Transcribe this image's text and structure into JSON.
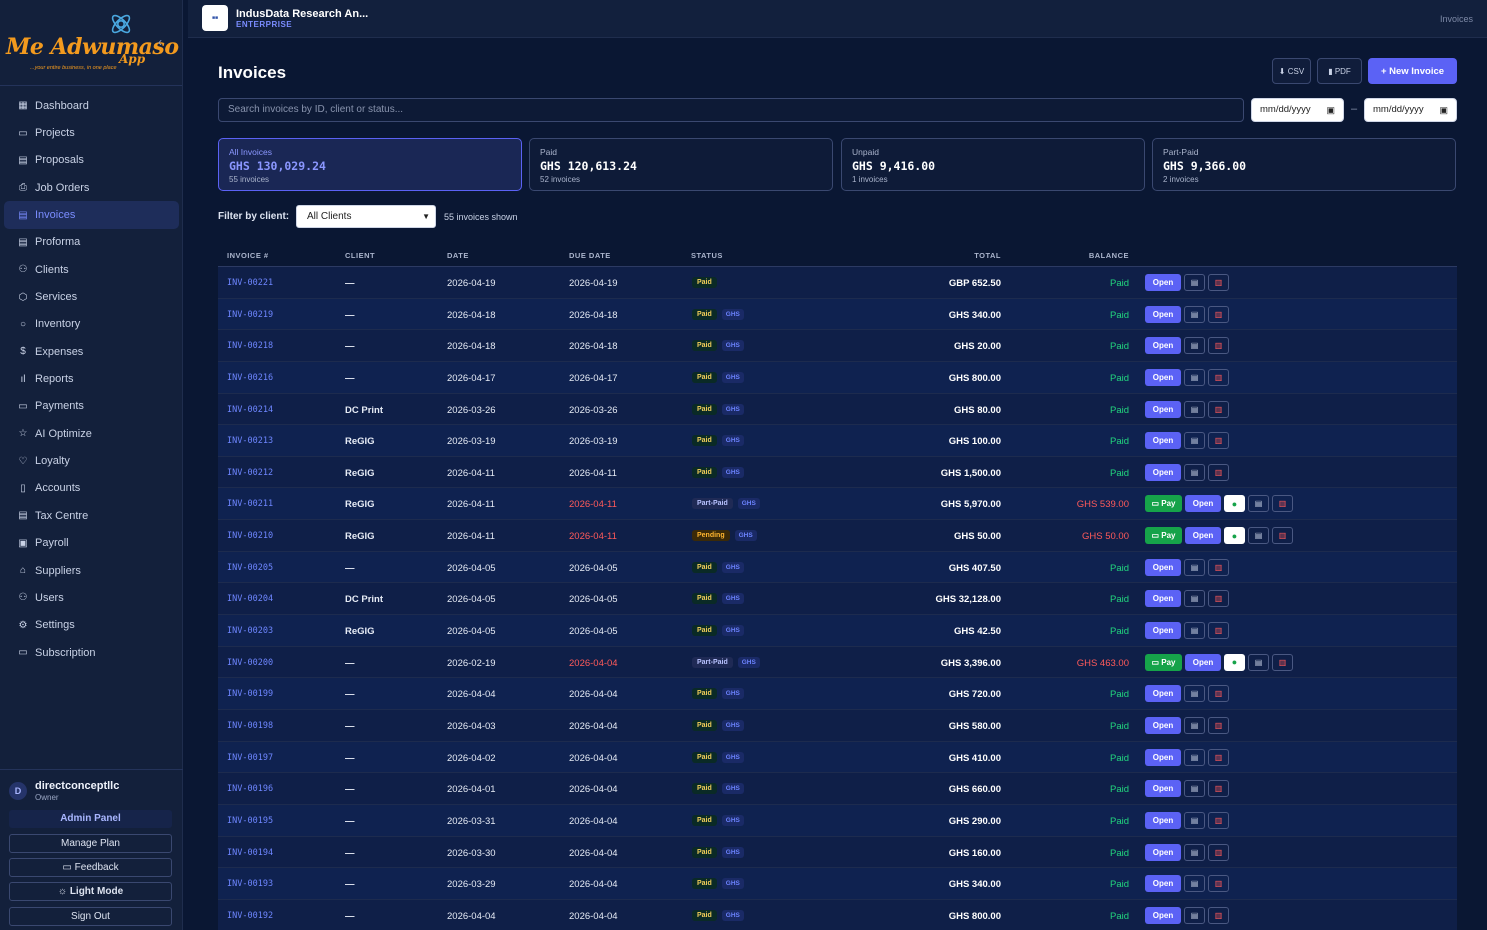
{
  "sidebar": {
    "logo_text": "Me Adwumaso",
    "logo_app": "App",
    "logo_tagline": "...your entire business, in one place",
    "items": [
      {
        "label": "Dashboard",
        "icon": "grid-icon",
        "glyph": "▦"
      },
      {
        "label": "Projects",
        "icon": "folder-icon",
        "glyph": "▭"
      },
      {
        "label": "Proposals",
        "icon": "file-icon",
        "glyph": "▤"
      },
      {
        "label": "Job Orders",
        "icon": "printer-icon",
        "glyph": "⎙"
      },
      {
        "label": "Invoices",
        "icon": "file-text-icon",
        "glyph": "▤",
        "active": true
      },
      {
        "label": "Proforma",
        "icon": "file-icon",
        "glyph": "▤"
      },
      {
        "label": "Clients",
        "icon": "users-icon",
        "glyph": "⚇"
      },
      {
        "label": "Services",
        "icon": "box-icon",
        "glyph": "⬡"
      },
      {
        "label": "Inventory",
        "icon": "circle-icon",
        "glyph": "○"
      },
      {
        "label": "Expenses",
        "icon": "dollar-icon",
        "glyph": "$"
      },
      {
        "label": "Reports",
        "icon": "bar-chart-icon",
        "glyph": "ıl"
      },
      {
        "label": "Payments",
        "icon": "credit-card-icon",
        "glyph": "▭"
      },
      {
        "label": "AI Optimize",
        "icon": "star-icon",
        "glyph": "☆"
      },
      {
        "label": "Loyalty",
        "icon": "heart-icon",
        "glyph": "♡"
      },
      {
        "label": "Accounts",
        "icon": "book-icon",
        "glyph": "▯"
      },
      {
        "label": "Tax Centre",
        "icon": "receipt-icon",
        "glyph": "▤"
      },
      {
        "label": "Payroll",
        "icon": "briefcase-icon",
        "glyph": "▣"
      },
      {
        "label": "Suppliers",
        "icon": "store-icon",
        "glyph": "⌂"
      },
      {
        "label": "Users",
        "icon": "user-check-icon",
        "glyph": "⚇"
      },
      {
        "label": "Settings",
        "icon": "gear-icon",
        "glyph": "⚙"
      },
      {
        "label": "Subscription",
        "icon": "credit-card-icon",
        "glyph": "▭"
      }
    ],
    "user": {
      "initial": "D",
      "name": "directconceptllc",
      "role": "Owner"
    },
    "admin_panel": "Admin Panel",
    "manage_plan": "Manage Plan",
    "feedback": "Feedback",
    "light_mode": "Light Mode",
    "sign_out": "Sign Out"
  },
  "header": {
    "org_name": "IndusData Research An...",
    "org_tier": "ENTERPRISE",
    "breadcrumb": "Invoices"
  },
  "page": {
    "title": "Invoices",
    "csv_label": "CSV",
    "pdf_label": "PDF",
    "new_invoice_label": "+ New Invoice",
    "search_placeholder": "Search invoices by ID, client or status...",
    "date_from": "mm/dd/yyyy",
    "date_to": "mm/dd/yyyy",
    "date_separator": "–"
  },
  "summary_cards": [
    {
      "label": "All Invoices",
      "value": "GHS 130,029.24",
      "sub": "55 invoices",
      "active": true
    },
    {
      "label": "Paid",
      "value": "GHS 120,613.24",
      "sub": "52 invoices"
    },
    {
      "label": "Unpaid",
      "value": "GHS 9,416.00",
      "sub": "1 invoices"
    },
    {
      "label": "Part-Paid",
      "value": "GHS 9,366.00",
      "sub": "2 invoices"
    }
  ],
  "filter": {
    "label": "Filter by client:",
    "selected": "All Clients",
    "count_text": "55 invoices shown"
  },
  "table": {
    "columns": [
      "INVOICE #",
      "CLIENT",
      "DATE",
      "DUE DATE",
      "STATUS",
      "TOTAL",
      "BALANCE"
    ],
    "rows": [
      {
        "inv": "INV-00221",
        "client": "—",
        "date": "2026-04-19",
        "due": "2026-04-19",
        "status": "Paid",
        "cur": "",
        "total": "GBP 652.50",
        "balance": "Paid"
      },
      {
        "inv": "INV-00219",
        "client": "—",
        "date": "2026-04-18",
        "due": "2026-04-18",
        "status": "Paid",
        "cur": "GHS",
        "total": "GHS 340.00",
        "balance": "Paid"
      },
      {
        "inv": "INV-00218",
        "client": "—",
        "date": "2026-04-18",
        "due": "2026-04-18",
        "status": "Paid",
        "cur": "GHS",
        "total": "GHS 20.00",
        "balance": "Paid"
      },
      {
        "inv": "INV-00216",
        "client": "—",
        "date": "2026-04-17",
        "due": "2026-04-17",
        "status": "Paid",
        "cur": "GHS",
        "total": "GHS 800.00",
        "balance": "Paid"
      },
      {
        "inv": "INV-00214",
        "client": "DC Print",
        "date": "2026-03-26",
        "due": "2026-03-26",
        "status": "Paid",
        "cur": "GHS",
        "total": "GHS 80.00",
        "balance": "Paid"
      },
      {
        "inv": "INV-00213",
        "client": "ReGIG",
        "date": "2026-03-19",
        "due": "2026-03-19",
        "status": "Paid",
        "cur": "GHS",
        "total": "GHS 100.00",
        "balance": "Paid"
      },
      {
        "inv": "INV-00212",
        "client": "ReGIG",
        "date": "2026-04-11",
        "due": "2026-04-11",
        "status": "Paid",
        "cur": "GHS",
        "total": "GHS 1,500.00",
        "balance": "Paid"
      },
      {
        "inv": "INV-00211",
        "client": "ReGIG",
        "date": "2026-04-11",
        "due": "2026-04-11",
        "overdue": true,
        "status": "Part-Paid",
        "cur": "GHS",
        "total": "GHS 5,970.00",
        "balance": "GHS 539.00",
        "owed": true
      },
      {
        "inv": "INV-00210",
        "client": "ReGIG",
        "date": "2026-04-11",
        "due": "2026-04-11",
        "overdue": true,
        "status": "Pending",
        "cur": "GHS",
        "total": "GHS 50.00",
        "balance": "GHS 50.00",
        "owed": true
      },
      {
        "inv": "INV-00205",
        "client": "—",
        "date": "2026-04-05",
        "due": "2026-04-05",
        "status": "Paid",
        "cur": "GHS",
        "total": "GHS 407.50",
        "balance": "Paid"
      },
      {
        "inv": "INV-00204",
        "client": "DC Print",
        "date": "2026-04-05",
        "due": "2026-04-05",
        "status": "Paid",
        "cur": "GHS",
        "total": "GHS 32,128.00",
        "balance": "Paid"
      },
      {
        "inv": "INV-00203",
        "client": "ReGIG",
        "date": "2026-04-05",
        "due": "2026-04-05",
        "status": "Paid",
        "cur": "GHS",
        "total": "GHS 42.50",
        "balance": "Paid"
      },
      {
        "inv": "INV-00200",
        "client": "—",
        "date": "2026-02-19",
        "due": "2026-04-04",
        "overdue": true,
        "status": "Part-Paid",
        "cur": "GHS",
        "total": "GHS 3,396.00",
        "balance": "GHS 463.00",
        "owed": true
      },
      {
        "inv": "INV-00199",
        "client": "—",
        "date": "2026-04-04",
        "due": "2026-04-04",
        "status": "Paid",
        "cur": "GHS",
        "total": "GHS 720.00",
        "balance": "Paid"
      },
      {
        "inv": "INV-00198",
        "client": "—",
        "date": "2026-04-03",
        "due": "2026-04-04",
        "status": "Paid",
        "cur": "GHS",
        "total": "GHS 580.00",
        "balance": "Paid"
      },
      {
        "inv": "INV-00197",
        "client": "—",
        "date": "2026-04-02",
        "due": "2026-04-04",
        "status": "Paid",
        "cur": "GHS",
        "total": "GHS 410.00",
        "balance": "Paid"
      },
      {
        "inv": "INV-00196",
        "client": "—",
        "date": "2026-04-01",
        "due": "2026-04-04",
        "status": "Paid",
        "cur": "GHS",
        "total": "GHS 660.00",
        "balance": "Paid"
      },
      {
        "inv": "INV-00195",
        "client": "—",
        "date": "2026-03-31",
        "due": "2026-04-04",
        "status": "Paid",
        "cur": "GHS",
        "total": "GHS 290.00",
        "balance": "Paid"
      },
      {
        "inv": "INV-00194",
        "client": "—",
        "date": "2026-03-30",
        "due": "2026-04-04",
        "status": "Paid",
        "cur": "GHS",
        "total": "GHS 160.00",
        "balance": "Paid"
      },
      {
        "inv": "INV-00193",
        "client": "—",
        "date": "2026-03-29",
        "due": "2026-04-04",
        "status": "Paid",
        "cur": "GHS",
        "total": "GHS 340.00",
        "balance": "Paid"
      },
      {
        "inv": "INV-00192",
        "client": "—",
        "date": "2026-04-04",
        "due": "2026-04-04",
        "status": "Paid",
        "cur": "GHS",
        "total": "GHS 800.00",
        "balance": "Paid"
      }
    ],
    "actions": {
      "pay": "Pay",
      "open": "Open"
    }
  },
  "colors": {
    "accent": "#5b62f5",
    "background": "#0a1733",
    "paid_green": "#22d67e",
    "overdue_red": "#ff5a5a",
    "pay_green": "#16a34a"
  }
}
